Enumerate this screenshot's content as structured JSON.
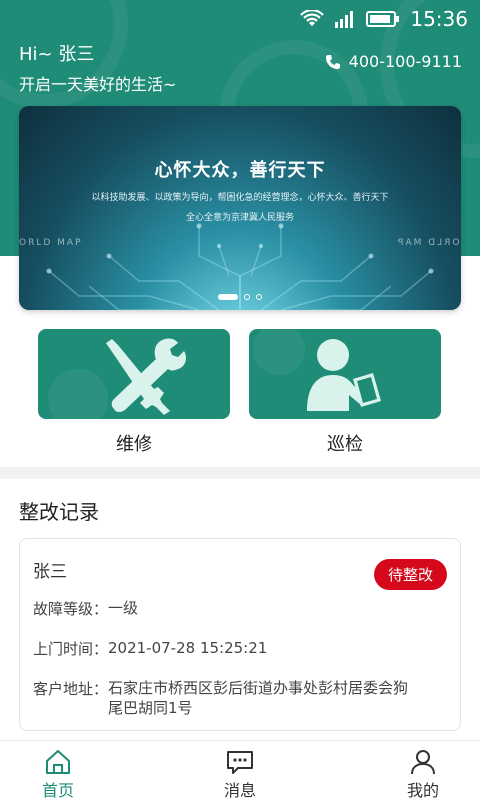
{
  "status_bar": {
    "time": "15:36"
  },
  "header": {
    "greeting": "Hi~ 张三",
    "motto": "开启一天美好的生活~",
    "phone": "400-100-9111"
  },
  "banner": {
    "title": "心怀大众，善行天下",
    "subtitle1": "以科技助发展、以政策为导向，帮困化急的经营理念，心怀大众、善行天下",
    "subtitle2": "全心全意为京津冀人民服务",
    "map_text_left": "ORLD MAP",
    "map_text_right": "ORLD MAP",
    "slide_count": 3,
    "active_slide": 1
  },
  "actions": [
    {
      "label": "维修",
      "icon": "wrench-screwdriver-icon"
    },
    {
      "label": "巡检",
      "icon": "inspector-clipboard-icon"
    }
  ],
  "section": {
    "title": "整改记录"
  },
  "record": {
    "name": "张三",
    "status": "待整改",
    "fields": [
      {
        "label": "故障等级：",
        "value": "一级"
      },
      {
        "label": "上门时间：",
        "value": "2021-07-28 15:25:21"
      },
      {
        "label": "客户地址：",
        "value": "石家庄市桥西区彭后街道办事处彭村居委会狗尾巴胡同1号"
      }
    ]
  },
  "tabs": [
    {
      "label": "首页",
      "icon": "home-icon",
      "active": true
    },
    {
      "label": "消息",
      "icon": "message-icon",
      "active": false
    },
    {
      "label": "我的",
      "icon": "profile-icon",
      "active": false
    }
  ],
  "colors": {
    "primary": "#1f8c77",
    "badge": "#d6091c"
  }
}
